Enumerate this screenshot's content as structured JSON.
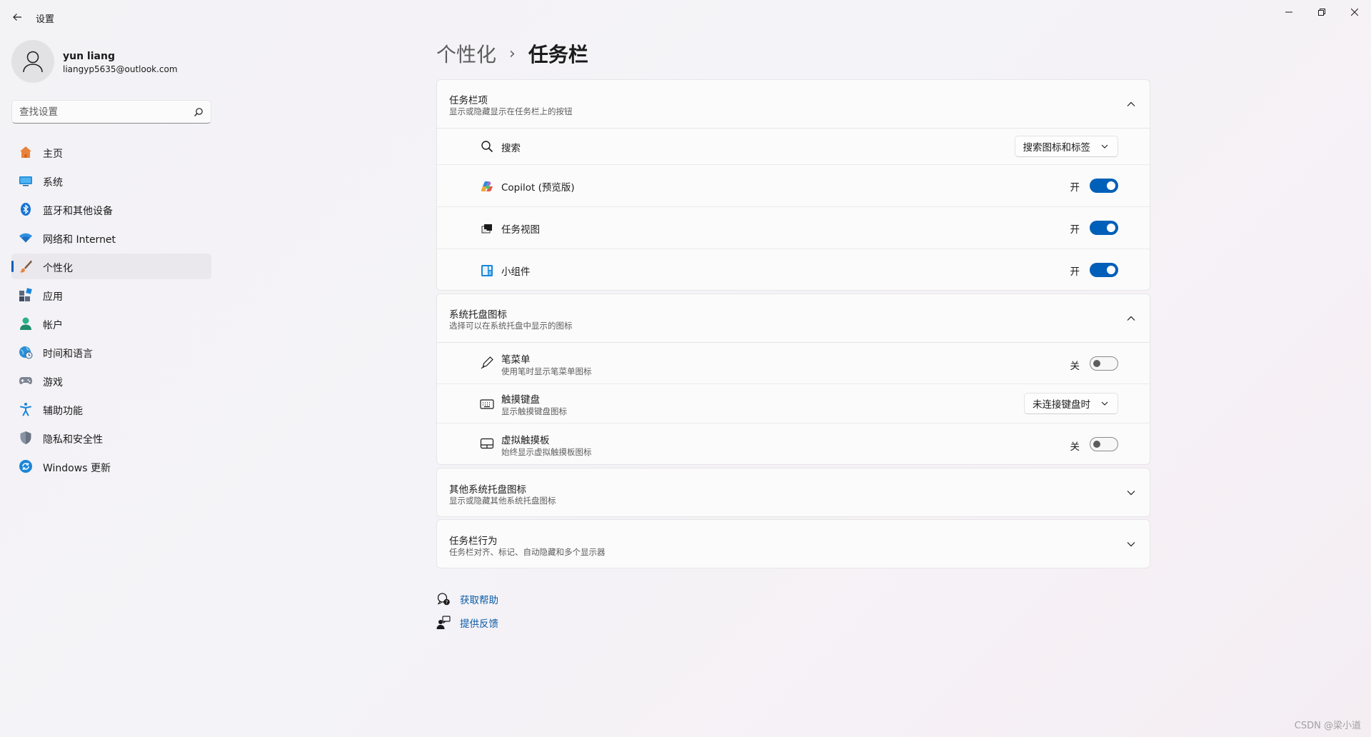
{
  "window": {
    "title": "设置",
    "controls": {
      "minimize": "minimize-icon",
      "maximize": "restore-icon",
      "close": "close-icon"
    }
  },
  "profile": {
    "name": "yun liang",
    "email": "liangyp5635@outlook.com"
  },
  "search": {
    "placeholder": "查找设置",
    "value": ""
  },
  "sidebar": {
    "items": [
      {
        "label": "主页",
        "icon": "home-icon",
        "active": false
      },
      {
        "label": "系统",
        "icon": "system-icon",
        "active": false
      },
      {
        "label": "蓝牙和其他设备",
        "icon": "bluetooth-icon",
        "active": false
      },
      {
        "label": "网络和 Internet",
        "icon": "wifi-icon",
        "active": false
      },
      {
        "label": "个性化",
        "icon": "brush-icon",
        "active": true
      },
      {
        "label": "应用",
        "icon": "apps-icon",
        "active": false
      },
      {
        "label": "帐户",
        "icon": "account-icon",
        "active": false
      },
      {
        "label": "时间和语言",
        "icon": "globe-clock-icon",
        "active": false
      },
      {
        "label": "游戏",
        "icon": "gamepad-icon",
        "active": false
      },
      {
        "label": "辅助功能",
        "icon": "accessibility-icon",
        "active": false
      },
      {
        "label": "隐私和安全性",
        "icon": "shield-icon",
        "active": false
      },
      {
        "label": "Windows 更新",
        "icon": "update-icon",
        "active": false
      }
    ]
  },
  "breadcrumb": {
    "parent": "个性化",
    "separator": "›",
    "current": "任务栏"
  },
  "groups": {
    "taskbar_items": {
      "title": "任务栏项",
      "subtitle": "显示或隐藏显示在任务栏上的按钮",
      "expanded": true,
      "rows": [
        {
          "label": "搜索",
          "icon": "search-icon",
          "control": "dropdown",
          "value": "搜索图标和标签"
        },
        {
          "label": "Copilot (预览版)",
          "icon": "copilot-icon",
          "control": "toggle",
          "state": "开",
          "on": true
        },
        {
          "label": "任务视图",
          "icon": "task-view-icon",
          "control": "toggle",
          "state": "开",
          "on": true
        },
        {
          "label": "小组件",
          "icon": "widgets-icon",
          "control": "toggle",
          "state": "开",
          "on": true
        }
      ]
    },
    "tray_icons": {
      "title": "系统托盘图标",
      "subtitle": "选择可以在系统托盘中显示的图标",
      "expanded": true,
      "rows": [
        {
          "label": "笔菜单",
          "sub": "使用笔时显示笔菜单图标",
          "icon": "pen-icon",
          "control": "toggle",
          "state": "关",
          "on": false
        },
        {
          "label": "触摸键盘",
          "sub": "显示触摸键盘图标",
          "icon": "keyboard-icon",
          "control": "dropdown",
          "value": "未连接键盘时"
        },
        {
          "label": "虚拟触摸板",
          "sub": "始终显示虚拟触摸板图标",
          "icon": "touchpad-icon",
          "control": "toggle",
          "state": "关",
          "on": false
        }
      ]
    },
    "other_tray": {
      "title": "其他系统托盘图标",
      "subtitle": "显示或隐藏其他系统托盘图标",
      "expanded": false
    },
    "behaviors": {
      "title": "任务栏行为",
      "subtitle": "任务栏对齐、标记、自动隐藏和多个显示器",
      "expanded": false
    }
  },
  "help": {
    "get_help": "获取帮助",
    "feedback": "提供反馈"
  },
  "watermark": "CSDN @梁小道",
  "colors": {
    "accent": "#005fb8",
    "link": "#0a5aa6"
  }
}
